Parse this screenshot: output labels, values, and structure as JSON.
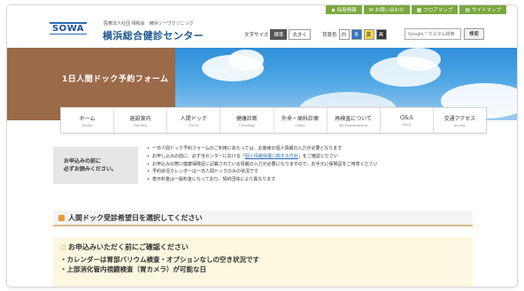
{
  "quick_links": [
    {
      "label": "採用情報",
      "icon": "person-icon"
    },
    {
      "label": "お問い合わせ",
      "icon": "mail-icon"
    },
    {
      "label": "フロアマップ",
      "icon": "map-icon"
    },
    {
      "label": "サイトマップ",
      "icon": "sitemap-icon"
    }
  ],
  "header": {
    "logo_text": "SOWA",
    "org_sub": "医療法人社団 相和会　横浜ソーワクリニック",
    "org_name": "横浜総合健診センター",
    "font_size_label": "文字サイズ",
    "font_standard": "標準",
    "font_large": "大きく",
    "bg_color_label": "背景色",
    "bg_white": "白",
    "bg_blue": "青",
    "bg_yellow": "黄",
    "bg_black": "黒",
    "search_placeholder": "Google™カスタム検索",
    "search_button": "検索"
  },
  "banner": {
    "title": "1日人間ドック予約フォーム"
  },
  "nav": [
    {
      "jp": "ホーム",
      "en": "Home"
    },
    {
      "jp": "施設案内",
      "en": "Facility"
    },
    {
      "jp": "人間ドック",
      "en": "Dock"
    },
    {
      "jp": "健康診断",
      "en": "Checkup"
    },
    {
      "jp": "外来・歯科診療",
      "en": "Clinic"
    },
    {
      "jp": "再検査について",
      "en": "Re-Examination"
    },
    {
      "jp": "Q&A",
      "en": "Q&A"
    },
    {
      "jp": "交通アクセス",
      "en": "access"
    }
  ],
  "notice": {
    "label_line1": "お申込みの前に",
    "label_line2": "必ずお読みください。",
    "items": [
      {
        "text": "一日人間ドック予約フォームのご利用にあたっては、お客様の個人情報の入力が必要となります"
      },
      {
        "pre": "お申し込みの前に、必ず当センターにおける「",
        "link": "個人情報保護に関する方針",
        "post": "」をご確認ください"
      },
      {
        "text": "お申込みの際に健康保険証に記載されている情報の入力が必要になりますので、お手元に保険証をご用意ください"
      },
      {
        "text": "予約状況カレンダーは一日人間ドックのみの状況です"
      },
      {
        "text": "表示料金は一般料金になっており、契約団体により異なります"
      }
    ]
  },
  "section": {
    "title": "人間ドック受診希望日を選択してください"
  },
  "confirm": {
    "title": "お申込みいただく前にご確認ください",
    "lines": [
      "・カレンダーは胃部バリウム検査・オプションなしの空き状況です",
      "・上部消化管内視鏡検査（胃カメラ）が可能な日"
    ]
  },
  "colors": {
    "accent_green": "#7aa83e",
    "brand_blue": "#1f5a8f",
    "banner_brown": "#9b6a49",
    "confirm_bg": "#fdf7df"
  }
}
